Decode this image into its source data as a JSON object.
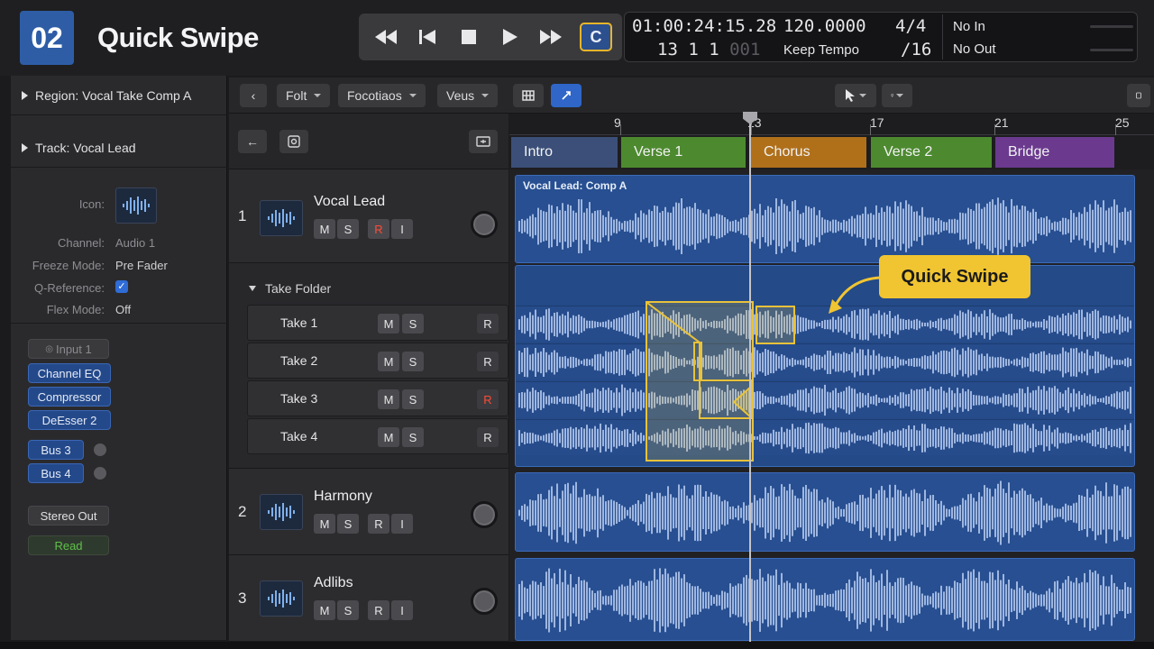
{
  "header": {
    "step": "02",
    "title": "Quick Swipe"
  },
  "transport": {
    "cycle_label": "C"
  },
  "lcd": {
    "timecode": "01:00:24:15.28",
    "bars": "13  1  1",
    "ticks": "001",
    "tempo": "120.0000",
    "tempo_mode": "Keep Tempo",
    "time_sig": "4/4",
    "division": "/16",
    "midi_in": "No In",
    "midi_out": "No Out"
  },
  "inspector": {
    "region": "Region: Vocal Take Comp A",
    "track": "Track: Vocal Lead",
    "icon_label": "Icon:",
    "channel_label": "Channel:",
    "channel_value": "Audio 1",
    "freeze_label": "Freeze Mode:",
    "freeze_value": "Pre Fader",
    "qref_label": "Q-Reference:",
    "flex_label": "Flex Mode:",
    "flex_value": "Off",
    "input": "Input 1",
    "plugins": [
      "Channel EQ",
      "Compressor",
      "DeEsser 2"
    ],
    "sends": [
      "Bus 3",
      "Bus 4"
    ],
    "output": "Stereo Out",
    "automation": "Read"
  },
  "toolbar": {
    "menus": [
      "Folt",
      "Focotiaos",
      "Veus"
    ]
  },
  "tracks": [
    {
      "num": "1",
      "name": "Vocal Lead"
    },
    {
      "num": "2",
      "name": "Harmony"
    },
    {
      "num": "3",
      "name": "Adlibs"
    }
  ],
  "msri": {
    "m": "M",
    "s": "S",
    "r": "R",
    "i": "I"
  },
  "take_folder": {
    "label": "Take Folder",
    "takes": [
      "Take 1",
      "Take 2",
      "Take 3",
      "Take 4"
    ]
  },
  "ruler": {
    "bars": [
      "9",
      "13",
      "17",
      "21",
      "25"
    ]
  },
  "markers": [
    "Intro",
    "Verse 1",
    "Chorus",
    "Verse 2",
    "Bridge"
  ],
  "colors": {
    "intro": "#3b4f78",
    "verse": "#4d8a2f",
    "chorus": "#b0701a",
    "bridge": "#6b3a8e",
    "region": "#274f91",
    "accent": "#f1c531"
  },
  "region_name": "Vocal Lead: Comp A",
  "callout": "Quick Swipe"
}
